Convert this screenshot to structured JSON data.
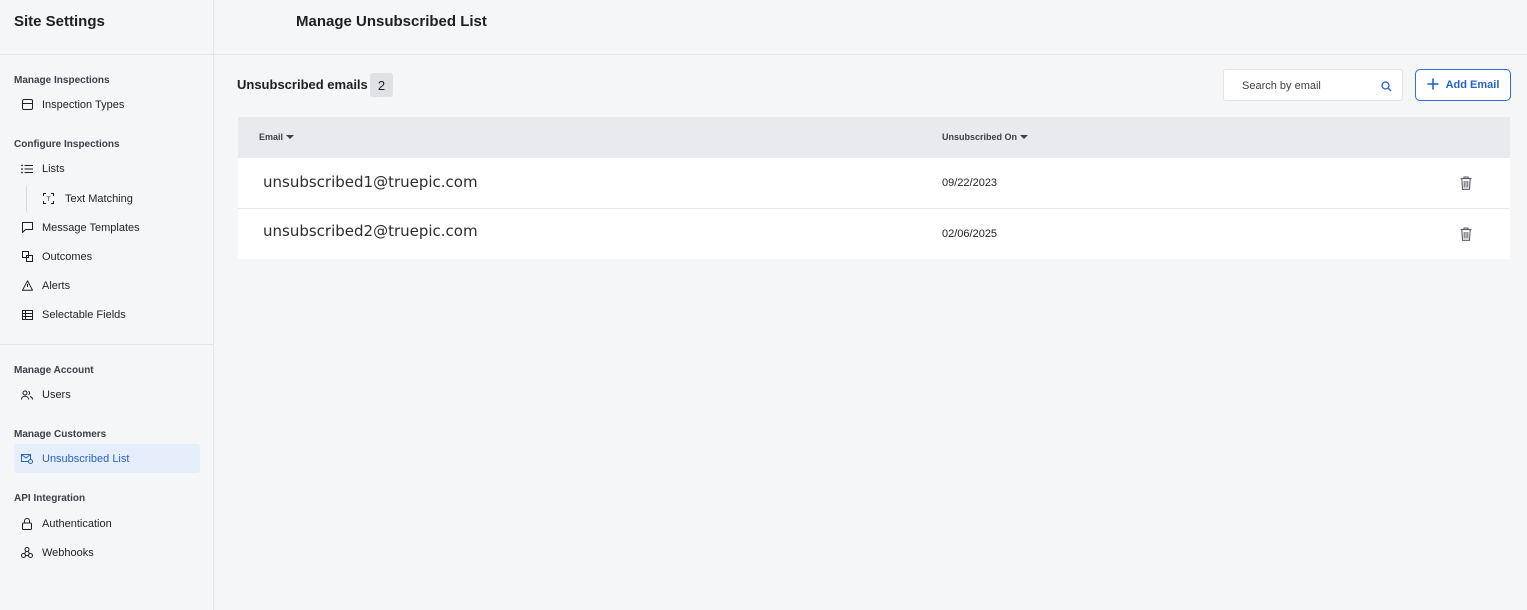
{
  "sidebar": {
    "title": "Site Settings",
    "sections": [
      {
        "label": "Manage Inspections"
      },
      {
        "label": "Configure Inspections"
      },
      {
        "label": "Manage Account"
      },
      {
        "label": "Manage Customers"
      },
      {
        "label": "API Integration"
      }
    ],
    "items": [
      {
        "label": "Inspection Types",
        "icon": "inspection-types-icon"
      },
      {
        "label": "Lists",
        "icon": "list-icon"
      },
      {
        "label": "Text Matching",
        "icon": "text-matching-icon"
      },
      {
        "label": "Message Templates",
        "icon": "message-icon"
      },
      {
        "label": "Outcomes",
        "icon": "outcomes-icon"
      },
      {
        "label": "Alerts",
        "icon": "alert-icon"
      },
      {
        "label": "Selectable Fields",
        "icon": "table-icon"
      },
      {
        "label": "Users",
        "icon": "users-icon"
      },
      {
        "label": "Unsubscribed List",
        "icon": "unsubscribed-icon",
        "active": true
      },
      {
        "label": "Authentication",
        "icon": "lock-icon"
      },
      {
        "label": "Webhooks",
        "icon": "webhook-icon"
      }
    ]
  },
  "header": {
    "title": "Manage Unsubscribed List"
  },
  "main": {
    "count_title": "Unsubscribed emails",
    "count": "2",
    "search_placeholder": "Search by email",
    "add_button_label": "Add Email",
    "columns": [
      "Email",
      "Unsubscribed On"
    ],
    "rows": [
      {
        "email": "unsubscribed1@truepic.com",
        "date": "09/22/2023"
      },
      {
        "email": "unsubscribed2@truepic.com",
        "date": "02/06/2025"
      }
    ]
  },
  "colors": {
    "accent": "#2563c9",
    "active_bg": "#e6eefb",
    "background": "#f5f6f8"
  }
}
